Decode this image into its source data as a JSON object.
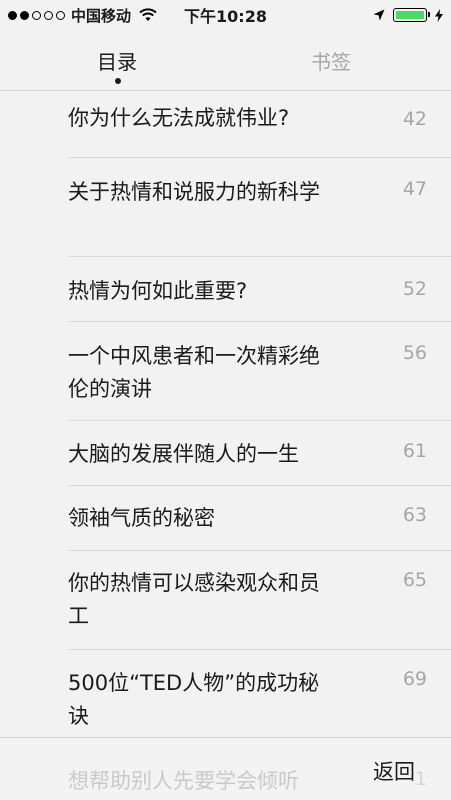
{
  "status_bar": {
    "carrier": "中国移动",
    "time": "下午10:28",
    "signal_strength": 2,
    "battery_color": "#4cd964"
  },
  "tabs": [
    {
      "label": "目录",
      "active": true
    },
    {
      "label": "书签",
      "active": false
    }
  ],
  "toc_items": [
    {
      "title": "你为什么无法成就伟业?",
      "page": "42"
    },
    {
      "title": "关于热情和说服力的新科学",
      "page": "47"
    },
    {
      "title": "热情为何如此重要?",
      "page": "52"
    },
    {
      "title": "一个中风患者和一次精彩绝伦的演讲",
      "page": "56"
    },
    {
      "title": "大脑的发展伴随人的一生",
      "page": "61"
    },
    {
      "title": "领袖气质的秘密",
      "page": "63"
    },
    {
      "title": "你的热情可以感染观众和员工",
      "page": "65"
    },
    {
      "title": "500位“TED人物”的成功秘诀",
      "page": "69"
    },
    {
      "title": "想帮助别人先要学会倾听",
      "page": "1"
    }
  ],
  "bottom_bar": {
    "back_label": "返回"
  }
}
